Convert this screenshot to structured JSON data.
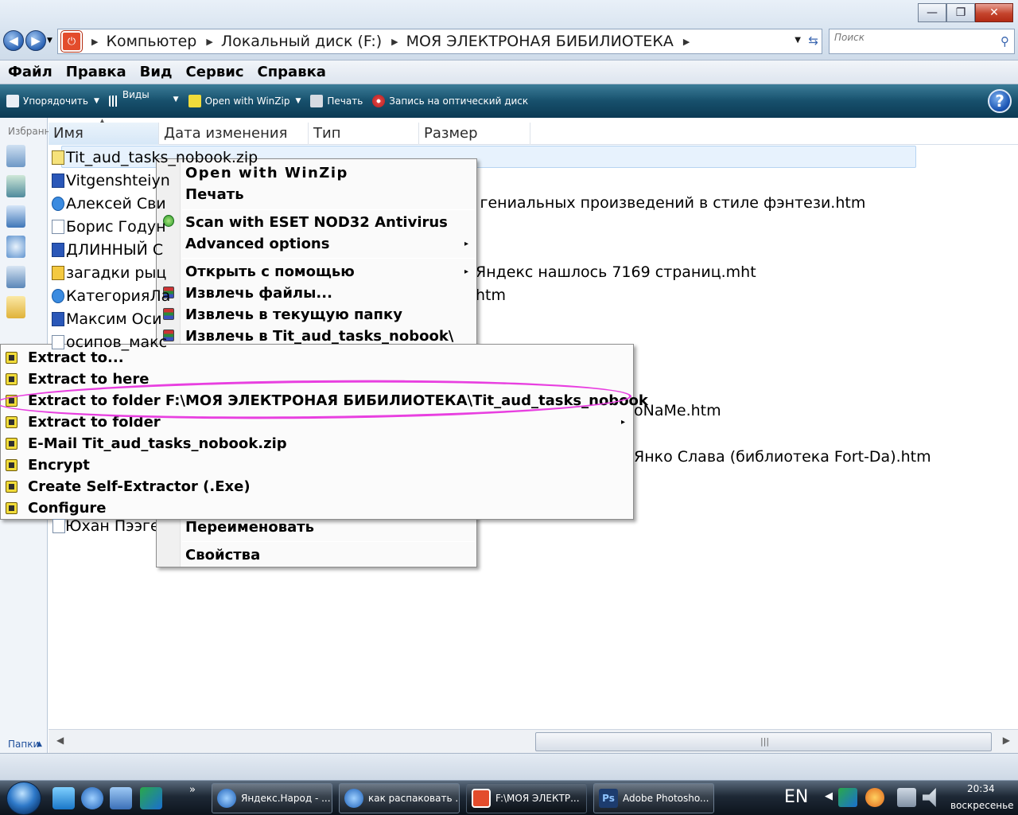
{
  "window": {
    "minimize_glyph": "—",
    "maximize_glyph": "❐",
    "close_glyph": "✕"
  },
  "address": {
    "crumbs": [
      "Компьютер",
      "Локальный диск (F:)",
      "МОЯ ЭЛЕКТРОНАЯ БИБИЛИОТЕКА"
    ],
    "search_placeholder": "Поиск"
  },
  "menubar": [
    "Файл",
    "Правка",
    "Вид",
    "Сервис",
    "Справка"
  ],
  "commandbar": {
    "organize": "Упорядочить",
    "views": "Виды",
    "open_winzip": "Open with WinZip",
    "print": "Печать",
    "burn": "Запись на оптический диск"
  },
  "leftpane": {
    "favorites_title": "Избранн",
    "folders_label": "Папки"
  },
  "columns": [
    "Имя",
    "Дата изменения",
    "Тип",
    "Размер"
  ],
  "files": [
    {
      "name": "Tit_aud_tasks_nobook.zip",
      "icon": "zip-icon"
    },
    {
      "name": "Vitgenshteiyn",
      "icon": "word-doc-icon"
    },
    {
      "name": "Алексей Сви",
      "icon": "ie-page-icon"
    },
    {
      "name": "Борис Годун",
      "icon": "text-file-icon"
    },
    {
      "name": "ДЛИННЫЙ С",
      "icon": "word-doc-icon"
    },
    {
      "name": "загадки рыц",
      "icon": "dll-file-icon"
    },
    {
      "name": "КатегорияЛа",
      "icon": "ie-page-icon"
    },
    {
      "name": "Максим Оси",
      "icon": "word-doc-icon"
    },
    {
      "name": "осипов_макс",
      "icon": "text-file-icon"
    }
  ],
  "visible_tails": {
    "row3": "я гениальных произведений в стиле фэнтези.htm",
    "row6": "Яндекс нашлось 7169 страниц.mht",
    "row7": "htm",
    "row12": "oNaMe.htm",
    "row14": "Янко Слава (библиотека Fort-Da).htm",
    "row17": "Юхан Пээгел"
  },
  "context_menu": {
    "open_winzip": "Open with WinZip",
    "print": "Печать",
    "scan_eset": "Scan with ESET NOD32 Antivirus",
    "advanced": "Advanced options",
    "open_with": "Открыть с помощью",
    "extract_files": "Извлечь файлы...",
    "extract_here": "Извлечь в текущую папку",
    "extract_to_named": "Извлечь в Tit_aud_tasks_nobook\\",
    "rename": "Переименовать",
    "properties": "Свойства"
  },
  "winzip_submenu": [
    "Extract to...",
    "Extract to here",
    "Extract to folder F:\\МОЯ ЭЛЕКТРОНАЯ БИБИЛИОТЕКА\\Tit_aud_tasks_nobook",
    "Extract to folder",
    "E-Mail Tit_aud_tasks_nobook.zip",
    "Encrypt",
    "Create Self-Extractor (.Exe)",
    "Configure"
  ],
  "taskbar": {
    "tasks": [
      "Яндекс.Народ - ...",
      "как распаковать ...",
      "F:\\МОЯ ЭЛЕКТР...",
      "Adobe Photosho..."
    ],
    "quick_launch_more": "»",
    "lang": "EN",
    "time": "20:34",
    "day": "воскресенье"
  },
  "colors": {
    "command_bar": "#17506c",
    "highlight_ring": "#e83fe0",
    "selection": "#e7f2fd"
  }
}
